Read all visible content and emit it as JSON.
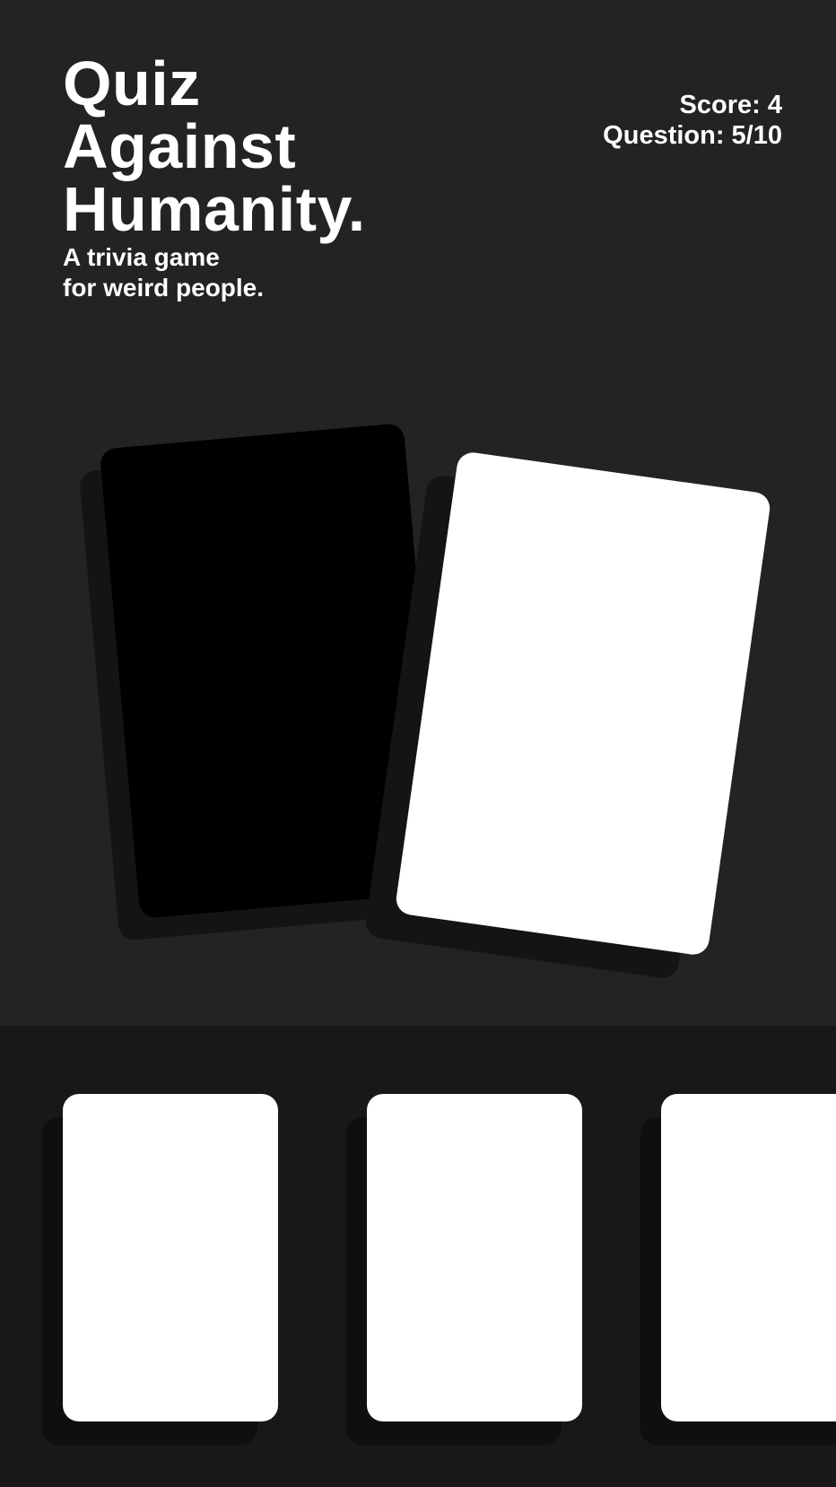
{
  "header": {
    "title_lines": [
      "Quiz",
      "Against",
      "Humanity."
    ],
    "subtitle_lines": [
      "A trivia game",
      "for weird people."
    ]
  },
  "stats": {
    "score": "Score: 4",
    "question": "Question: 5/10"
  },
  "table": {
    "question_card": {
      "color": "#000000",
      "text": ""
    },
    "answer_card": {
      "color": "#ffffff",
      "text": ""
    }
  },
  "hand": {
    "cards": [
      {
        "text": ""
      },
      {
        "text": ""
      },
      {
        "text": ""
      }
    ]
  },
  "colors": {
    "background": "#232323",
    "hand_background": "#181818",
    "text": "#ffffff"
  }
}
